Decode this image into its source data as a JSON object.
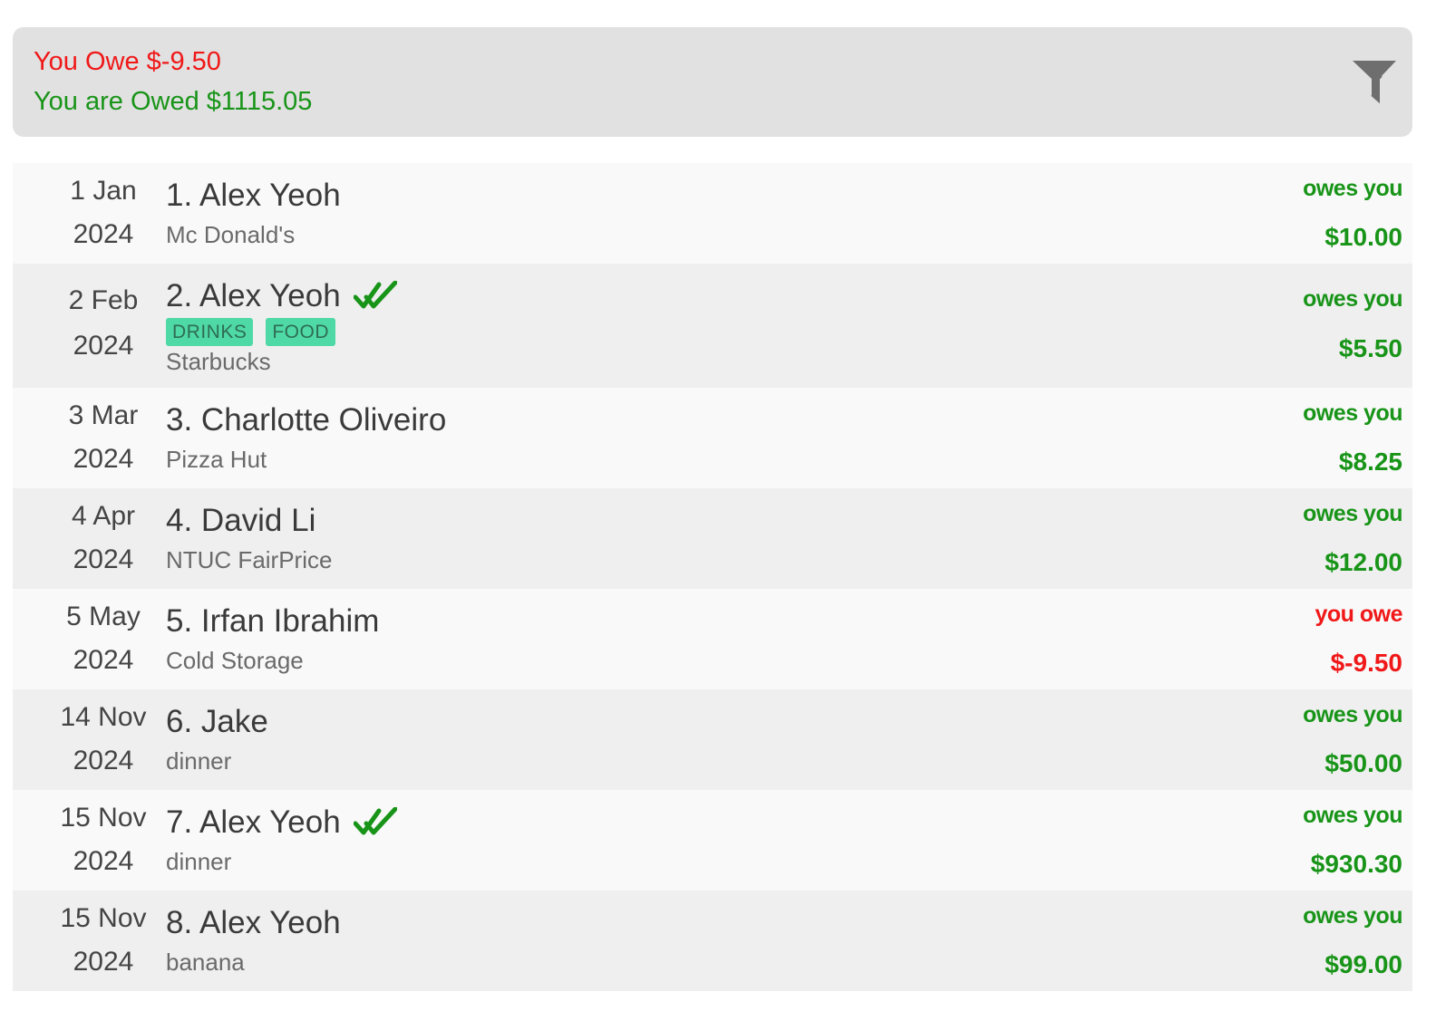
{
  "summary": {
    "you_owe": "You Owe $-9.50",
    "you_are_owed": "You are Owed $1115.05",
    "filter_icon": "funnel-filter-icon"
  },
  "colors": {
    "negative": "#f01818",
    "positive": "#189418",
    "tag_bg": "#4fd9a6",
    "check": "#189418"
  },
  "transactions": [
    {
      "day": "1 Jan",
      "year": "2024",
      "title": "1. Alex Yeoh",
      "settled": false,
      "tags": [],
      "desc": "Mc Donald's",
      "status": "owes you",
      "amount": "$10.00",
      "direction": "positive"
    },
    {
      "day": "2 Feb",
      "year": "2024",
      "title": "2. Alex Yeoh",
      "settled": true,
      "tags": [
        "DRINKS",
        "FOOD"
      ],
      "desc": "Starbucks",
      "status": "owes you",
      "amount": "$5.50",
      "direction": "positive"
    },
    {
      "day": "3 Mar",
      "year": "2024",
      "title": "3. Charlotte Oliveiro",
      "settled": false,
      "tags": [],
      "desc": "Pizza Hut",
      "status": "owes you",
      "amount": "$8.25",
      "direction": "positive"
    },
    {
      "day": "4 Apr",
      "year": "2024",
      "title": "4. David Li",
      "settled": false,
      "tags": [],
      "desc": "NTUC FairPrice",
      "status": "owes you",
      "amount": "$12.00",
      "direction": "positive"
    },
    {
      "day": "5 May",
      "year": "2024",
      "title": "5. Irfan Ibrahim",
      "settled": false,
      "tags": [],
      "desc": "Cold Storage",
      "status": "you owe",
      "amount": "$-9.50",
      "direction": "negative"
    },
    {
      "day": "14 Nov",
      "year": "2024",
      "title": "6. Jake",
      "settled": false,
      "tags": [],
      "desc": "dinner",
      "status": "owes you",
      "amount": "$50.00",
      "direction": "positive"
    },
    {
      "day": "15 Nov",
      "year": "2024",
      "title": "7. Alex Yeoh",
      "settled": true,
      "tags": [],
      "desc": "dinner",
      "status": "owes you",
      "amount": "$930.30",
      "direction": "positive"
    },
    {
      "day": "15 Nov",
      "year": "2024",
      "title": "8. Alex Yeoh",
      "settled": false,
      "tags": [],
      "desc": "banana",
      "status": "owes you",
      "amount": "$99.00",
      "direction": "positive"
    }
  ]
}
